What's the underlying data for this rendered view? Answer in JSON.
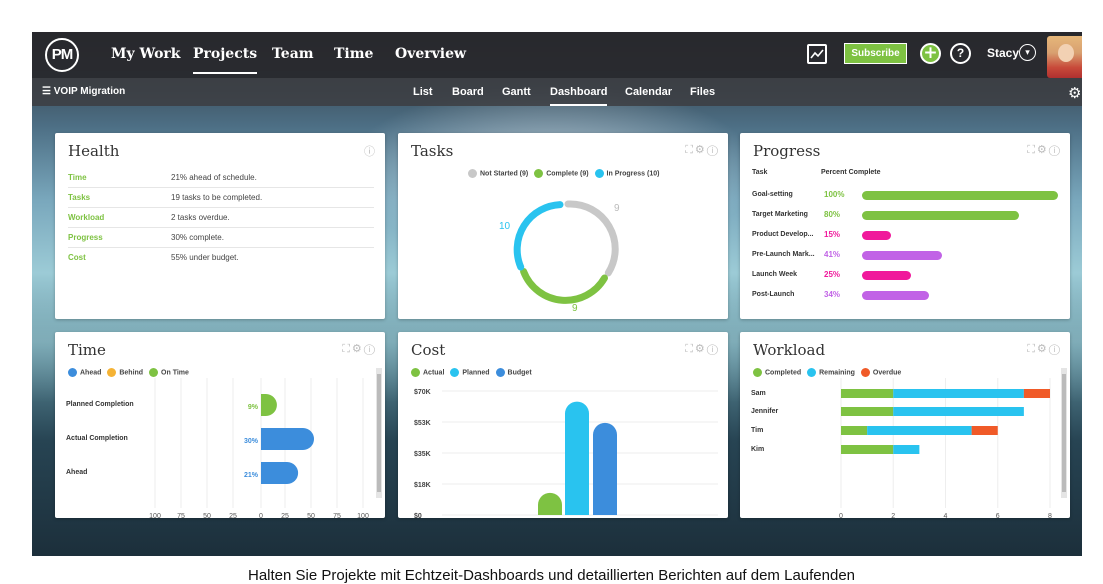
{
  "app": {
    "logo": "PM",
    "nav": [
      "My Work",
      "Projects",
      "Team",
      "Time",
      "Overview"
    ],
    "subscribe": "Subscribe",
    "help": "?",
    "user": "Stacy"
  },
  "subnav": {
    "project": "VOIP Migration",
    "tabs": [
      "List",
      "Board",
      "Gantt",
      "Dashboard",
      "Calendar",
      "Files"
    ]
  },
  "health": {
    "title": "Health",
    "rows": [
      {
        "name": "Time",
        "value": "21% ahead of schedule."
      },
      {
        "name": "Tasks",
        "value": "19 tasks to be completed."
      },
      {
        "name": "Workload",
        "value": "2 tasks overdue."
      },
      {
        "name": "Progress",
        "value": "30% complete."
      },
      {
        "name": "Cost",
        "value": "55% under budget."
      }
    ]
  },
  "tasks": {
    "title": "Tasks",
    "legend": [
      "Not Started (9)",
      "Complete (9)",
      "In Progress (10)"
    ],
    "colors": [
      "#c8c8c8",
      "#7ec242",
      "#29c3ef"
    ],
    "labels": {
      "not_started": "9",
      "complete": "9",
      "in_progress": "10"
    }
  },
  "progress": {
    "title": "Progress",
    "col_task": "Task",
    "col_pct": "Percent Complete",
    "rows": [
      {
        "name": "Goal-setting",
        "pct": "100%",
        "value": 1.0,
        "color": "#7ec242"
      },
      {
        "name": "Target Marketing",
        "pct": "80%",
        "value": 0.8,
        "color": "#7ec242"
      },
      {
        "name": "Product Develop...",
        "pct": "15%",
        "value": 0.15,
        "color": "#f0199b"
      },
      {
        "name": "Pre-Launch Mark...",
        "pct": "41%",
        "value": 0.41,
        "color": "#c163e6"
      },
      {
        "name": "Launch Week",
        "pct": "25%",
        "value": 0.25,
        "color": "#f0199b"
      },
      {
        "name": "Post-Launch",
        "pct": "34%",
        "value": 0.34,
        "color": "#c163e6"
      }
    ]
  },
  "time": {
    "title": "Time",
    "legend": [
      "Ahead",
      "Behind",
      "On Time"
    ],
    "legend_colors": [
      "#3c8ddc",
      "#f5b335",
      "#7ec242"
    ]
  },
  "cost": {
    "title": "Cost",
    "legend": [
      "Actual",
      "Planned",
      "Budget"
    ],
    "legend_colors": [
      "#7ec242",
      "#29c3ef",
      "#3c8ddc"
    ]
  },
  "workload": {
    "title": "Workload",
    "legend": [
      "Completed",
      "Remaining",
      "Overdue"
    ],
    "legend_colors": [
      "#7ec242",
      "#29c3ef",
      "#f05a28"
    ]
  },
  "chart_data": [
    {
      "type": "bar",
      "title": "Time",
      "orientation": "horizontal",
      "categories": [
        "Planned Completion",
        "Actual Completion",
        "Ahead"
      ],
      "values": [
        9,
        30,
        21
      ],
      "value_labels": [
        "9%",
        "30%",
        "21%"
      ],
      "colors": [
        "#7ec242",
        "#3c8ddc",
        "#3c8ddc"
      ],
      "x_ticks": [
        "100",
        "75",
        "50",
        "25",
        "0",
        "25",
        "50",
        "75",
        "100"
      ],
      "xlim": [
        -100,
        100
      ]
    },
    {
      "type": "bar",
      "title": "Cost",
      "categories": [
        "Actual",
        "Planned",
        "Budget"
      ],
      "values": [
        12.5,
        64,
        52
      ],
      "colors": [
        "#7ec242",
        "#29c3ef",
        "#3c8ddc"
      ],
      "y_ticks": [
        "$70K",
        "$53K",
        "$35K",
        "$18K",
        "$0"
      ],
      "ylim": [
        0,
        70
      ]
    },
    {
      "type": "bar",
      "title": "Workload",
      "orientation": "horizontal",
      "stacked": true,
      "categories": [
        "Sam",
        "Jennifer",
        "Tim",
        "Kim"
      ],
      "series": [
        {
          "name": "Completed",
          "values": [
            2,
            2,
            1,
            2
          ]
        },
        {
          "name": "Remaining",
          "values": [
            5,
            5,
            4,
            1
          ]
        },
        {
          "name": "Overdue",
          "values": [
            1,
            0,
            1,
            0
          ]
        }
      ],
      "colors": [
        "#7ec242",
        "#29c3ef",
        "#f05a28"
      ],
      "x_ticks": [
        "0",
        "2",
        "4",
        "6",
        "8"
      ],
      "xlim": [
        0,
        8
      ]
    }
  ],
  "caption": "Halten Sie Projekte mit Echtzeit-Dashboards und detaillierten Berichten auf dem Laufenden"
}
